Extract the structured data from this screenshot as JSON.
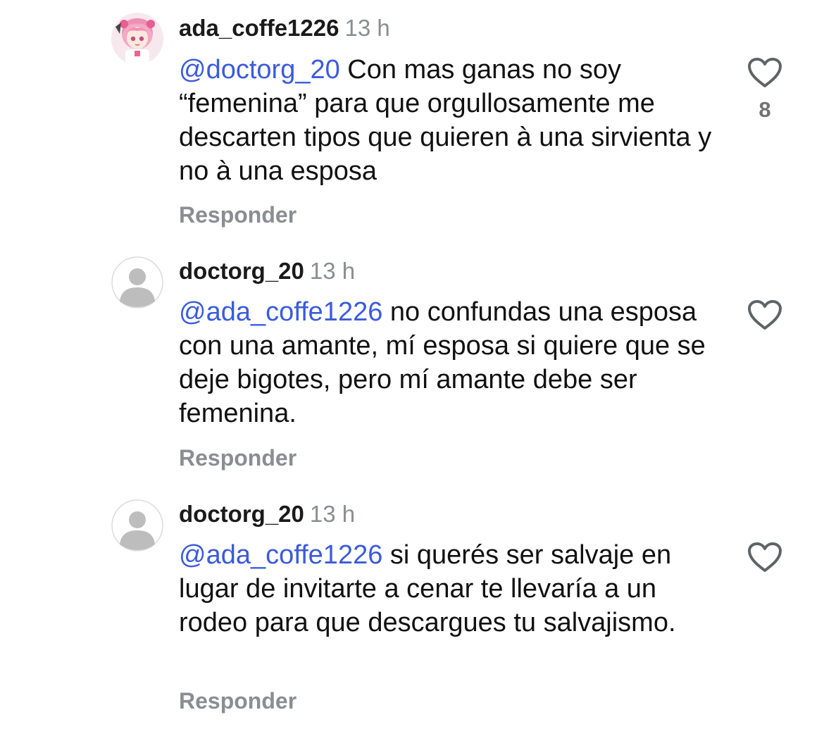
{
  "comments": [
    {
      "username": "ada_coffe1226",
      "time": "13 h",
      "mention": "@doctorg_20",
      "text": " Con mas ganas no soy “femenina” para que orgullosamente me descarten tipos que quieren à una sirvienta y no à una esposa",
      "reply_label": "Responder",
      "likes": "8",
      "avatar": "anime-avatar"
    },
    {
      "username": "doctorg_20",
      "time": "13 h",
      "mention": "@ada_coffe1226",
      "text": " no confundas una esposa con una amante, mí esposa si quiere que se deje bigotes, pero mí amante debe ser femenina.",
      "reply_label": "Responder",
      "likes": "",
      "avatar": "default-avatar"
    },
    {
      "username": "doctorg_20",
      "time": "13 h",
      "mention": "@ada_coffe1226",
      "text": " si querés ser salvaje en lugar de invitarte a cenar te llevaría a un rodeo para que descargues tu salvajismo.",
      "reply_label": "Responder",
      "likes": "",
      "avatar": "default-avatar"
    }
  ],
  "colors": {
    "mention": "#3b5bdb",
    "meta": "#8a8d91",
    "text": "#111111",
    "icon": "#5f6368"
  }
}
